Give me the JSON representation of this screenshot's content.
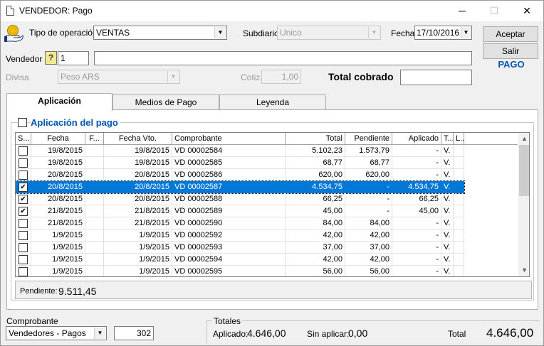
{
  "window": {
    "title": "VENDEDOR: Pago",
    "minimize": "─",
    "maximize": "☐",
    "close": "✕"
  },
  "header": {
    "tipo_label": "Tipo de operación",
    "tipo_value": "VENTAS",
    "subdiario_label": "Subdiario",
    "subdiario_value": "Unico",
    "fecha_label": "Fecha",
    "fecha_value": "17/10/2016",
    "vendedor_label": "Vendedor",
    "vendedor_code": "1",
    "vendedor_name": "",
    "divisa_label": "Divisa",
    "divisa_value": "Peso ARS",
    "cotiz_label": "Cotiz.",
    "cotiz_value": "1,00",
    "total_cobrado_label": "Total cobrado",
    "total_cobrado_value": "",
    "pago_label": "PAGO"
  },
  "buttons": {
    "aceptar": "Aceptar",
    "salir": "Salir"
  },
  "tabs": [
    {
      "label": "Aplicación"
    },
    {
      "label": "Medios de Pago"
    },
    {
      "label": "Leyenda"
    }
  ],
  "aplicacion": {
    "group_label": "Aplicación del pago",
    "columns": [
      "S...",
      "Fecha",
      "F...",
      "Fecha Vto.",
      "Comprobante",
      "Total",
      "Pendiente",
      "Aplicado",
      "T...",
      "L..."
    ],
    "rows": [
      {
        "checked": false,
        "fecha": "19/8/2015",
        "f": "",
        "vto": "19/8/2015",
        "comp": "VD 00002584",
        "total": "5.102,23",
        "pend": "1.573,79",
        "aplic": "-",
        "t": "V.",
        "l": ""
      },
      {
        "checked": false,
        "fecha": "19/8/2015",
        "f": "",
        "vto": "19/8/2015",
        "comp": "VD 00002585",
        "total": "68,77",
        "pend": "68,77",
        "aplic": "-",
        "t": "V.",
        "l": ""
      },
      {
        "checked": false,
        "fecha": "20/8/2015",
        "f": "",
        "vto": "20/8/2015",
        "comp": "VD 00002586",
        "total": "620,00",
        "pend": "620,00",
        "aplic": "-",
        "t": "V.",
        "l": ""
      },
      {
        "checked": true,
        "selected": true,
        "fecha": "20/8/2015",
        "f": "",
        "vto": "20/8/2015",
        "comp": "VD 00002587",
        "total": "4.534,75",
        "pend": "-",
        "aplic": "4.534,75",
        "t": "V.",
        "l": ""
      },
      {
        "checked": true,
        "fecha": "20/8/2015",
        "f": "",
        "vto": "20/8/2015",
        "comp": "VD 00002588",
        "total": "66,25",
        "pend": "-",
        "aplic": "66,25",
        "t": "V.",
        "l": ""
      },
      {
        "checked": true,
        "fecha": "21/8/2015",
        "f": "",
        "vto": "21/8/2015",
        "comp": "VD 00002589",
        "total": "45,00",
        "pend": "-",
        "aplic": "45,00",
        "t": "V.",
        "l": ""
      },
      {
        "checked": false,
        "fecha": "21/8/2015",
        "f": "",
        "vto": "21/8/2015",
        "comp": "VD 00002590",
        "total": "84,00",
        "pend": "84,00",
        "aplic": "-",
        "t": "V.",
        "l": ""
      },
      {
        "checked": false,
        "fecha": "1/9/2015",
        "f": "",
        "vto": "1/9/2015",
        "comp": "VD 00002592",
        "total": "42,00",
        "pend": "42,00",
        "aplic": "-",
        "t": "V.",
        "l": ""
      },
      {
        "checked": false,
        "fecha": "1/9/2015",
        "f": "",
        "vto": "1/9/2015",
        "comp": "VD 00002593",
        "total": "37,00",
        "pend": "37,00",
        "aplic": "-",
        "t": "V.",
        "l": ""
      },
      {
        "checked": false,
        "fecha": "1/9/2015",
        "f": "",
        "vto": "1/9/2015",
        "comp": "VD 00002594",
        "total": "42,00",
        "pend": "42,00",
        "aplic": "-",
        "t": "V.",
        "l": ""
      },
      {
        "checked": false,
        "fecha": "1/9/2015",
        "f": "",
        "vto": "1/9/2015",
        "comp": "VD 00002595",
        "total": "56,00",
        "pend": "56,00",
        "aplic": "-",
        "t": "V.",
        "l": ""
      }
    ],
    "pendiente_label": "Pendiente:",
    "pendiente_value": "9.511,45"
  },
  "footer": {
    "comprobante_label": "Comprobante",
    "comprobante_value": "Vendedores - Pagos",
    "comprobante_num": "302",
    "totales_label": "Totales",
    "aplicado_label": "Aplicado:",
    "aplicado_value": "4.646,00",
    "sin_aplicar_label": "Sin aplicar:",
    "sin_aplicar_value": "0,00",
    "total_label": "Total",
    "total_value": "4.646,00"
  },
  "colors": {
    "selection": "#0078d7",
    "accent": "#0055b0",
    "title_bg": "#ffffff"
  },
  "icons": {
    "tipo": "hand-coin-icon",
    "vendedor_lookup": "question-mark-icon",
    "window": "document-icon"
  }
}
